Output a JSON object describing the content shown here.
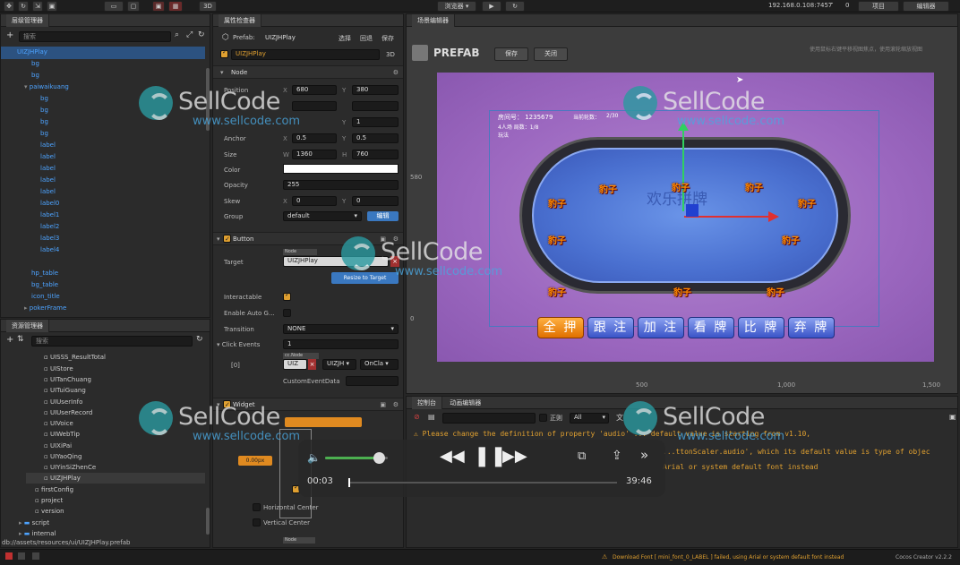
{
  "topbar": {
    "preview_label": "浏览器 ▾",
    "ip": "192.168.0.108:7457",
    "signal": "0",
    "project_btn": "项目",
    "editor_btn": "编辑器",
    "mode_3d": "3D"
  },
  "hierarchy": {
    "title": "层级管理器",
    "search_placeholder": "搜索",
    "rows": [
      "UIZJHPlay",
      "bg",
      "bg",
      "paiwaikuang",
      "bg",
      "bg",
      "bg",
      "bg",
      "label",
      "label",
      "label",
      "label",
      "label",
      "label0",
      "label1",
      "label2",
      "label3",
      "label4",
      "hp_table",
      "bg_table",
      "icon_title",
      "pokerFrame"
    ]
  },
  "assets": {
    "title": "资源管理器",
    "search_placeholder": "搜索",
    "rows": [
      "UISSS_ResultTotal",
      "UIStore",
      "UITanChuang",
      "UITuiGuang",
      "UIUserInfo",
      "UIUserRecord",
      "UIVoice",
      "UIWebTip",
      "UIXiPai",
      "UIYaoQing",
      "UIYinSiZhenCe",
      "UIZJHPlay",
      "firstConfig",
      "project",
      "version",
      "script",
      "internal"
    ],
    "path": "db://assets/resources/ui/UIZJHPlay.prefab"
  },
  "inspector": {
    "title": "属性检查器",
    "prefab_label": "Prefab:",
    "prefab_name": "UIZJHPlay",
    "select_btn": "选择",
    "revert_btn": "回退",
    "save_btn": "保存",
    "node_name": "UIZJHPlay",
    "mode": "3D",
    "node_section": "Node",
    "position_label": "Position",
    "pos_x": "680",
    "pos_y": "380",
    "scale_y": "1",
    "anchor_label": "Anchor",
    "anchor_x": "0.5",
    "anchor_y": "0.5",
    "size_label": "Size",
    "size_w": "1360",
    "size_h": "760",
    "color_label": "Color",
    "opacity_label": "Opacity",
    "opacity": "255",
    "skew_label": "Skew",
    "skew_x": "0",
    "skew_y": "0",
    "group_label": "Group",
    "group_value": "default",
    "group_edit": "编辑",
    "button_section": "Button",
    "target_label": "Target",
    "target_tag": "Node",
    "target_value": "UIZJHPlay",
    "resize_btn": "Resize to Target",
    "interactable_label": "Interactable",
    "enable_auto_label": "Enable Auto G...",
    "transition_label": "Transition",
    "transition_value": "NONE",
    "click_events_label": "Click Events",
    "click_events_count": "1",
    "event_index": "[0]",
    "event_tag": "cc.Node",
    "event_node": "UIZ",
    "event_comp": "UIZJH ▾",
    "event_handler": "OnCla ▾",
    "custom_data_label": "CustomEventData",
    "widget_section": "Widget",
    "widget_value": "0.00px",
    "horiz_center": "Horizontal Center",
    "vert_center": "Vertical Center",
    "bottom_tag": "Node"
  },
  "scene": {
    "title": "场景编辑器",
    "prefab_title": "PREFAB",
    "save_btn": "保存",
    "close_btn": "关闭",
    "hint": "使用鼠标右键平移视图焦点，使用滚轮缩放视图",
    "room_label": "房间号： 1235679",
    "round_label": "当前轮数：",
    "round_value": "2/30",
    "players_label": "4人场  局数：1/8",
    "play_label": "玩法",
    "table_text": "欢乐拼牌",
    "badge": "豹子",
    "buttons": [
      "全 押",
      "跟 注",
      "加 注",
      "看 牌",
      "比 牌",
      "弃 牌"
    ],
    "y_label": "580",
    "y_zero": "0",
    "x_ticks": [
      "500",
      "1,000",
      "1,500"
    ]
  },
  "console": {
    "tab1": "控制台",
    "tab2": "动画编辑器",
    "regex": "正则",
    "filter": "All",
    "lines": [
      "⚠ Please change the definition of property 'audio' ... default value is starting from v1.10,",
      "  ...ttonScaler.audio', which its default value is type of objec",
      "  Arial or system default font instead"
    ]
  },
  "video": {
    "current": "00:03",
    "total": "39:46",
    "volume": 0.85,
    "progress": 0.001
  },
  "status": {
    "message": "Download Font [ mini_font_0_LABEL ] failed, using Arial or system default font instead",
    "version": "Cocos Creator v2.2.2"
  },
  "watermark": {
    "brand": "SellCode",
    "url": "www.sellcode.com"
  },
  "colors": {
    "accent": "#e0a030",
    "table_blue": "#4a70d0",
    "bg_purple": "#a070c0",
    "orange_btn": "#f08a10"
  }
}
